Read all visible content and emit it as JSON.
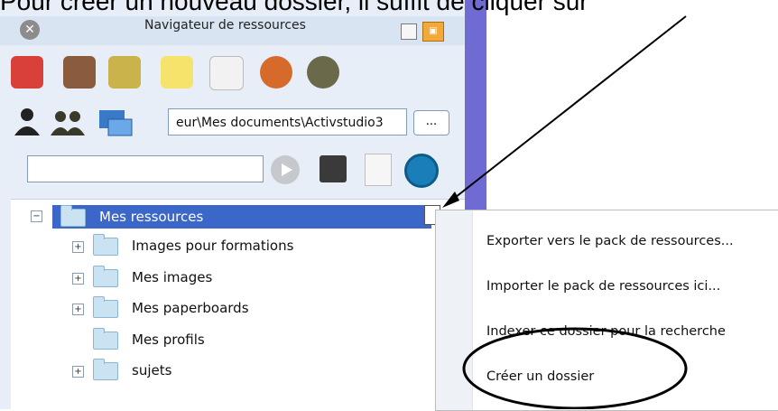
{
  "caption": "Pour créer un nouveau dossier, il suffit de cliquer sur",
  "window": {
    "title": "Navigateur de ressources"
  },
  "toolbar": {
    "path_value": "eur\\Mes documents\\Activstudio3",
    "browse_label": "...",
    "search_value": ""
  },
  "tree": {
    "root": "Mes ressources",
    "items": [
      {
        "label": "Images pour formations",
        "expandable": true
      },
      {
        "label": "Mes images",
        "expandable": true
      },
      {
        "label": "Mes paperboards",
        "expandable": true
      },
      {
        "label": "Mes profils",
        "expandable": false
      },
      {
        "label": "sujets",
        "expandable": true
      }
    ]
  },
  "context_menu": {
    "items": [
      "Exporter vers le pack de ressources...",
      "Importer le pack de ressources ici...",
      "Indexer ce dossier pour la recherche",
      "Créer un dossier"
    ]
  },
  "colors": {
    "selection": "#3b67c8",
    "panel": "#e7eef7",
    "accent_bar": "#6f6bd2"
  }
}
